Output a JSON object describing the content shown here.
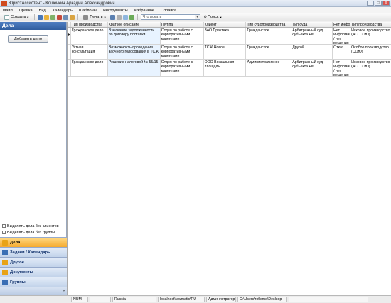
{
  "window": {
    "title": "ЮристАссистент - Кошечкин Аркадий Александрович",
    "minimize": "_",
    "maximize": "□",
    "close": "x"
  },
  "menu": [
    "Файл",
    "Правка",
    "Вид",
    "Календарь",
    "Шаблоны",
    "Инструменты",
    "Избранное",
    "Справка"
  ],
  "toolbar": {
    "create_label": "Создать",
    "print_label": "Печать",
    "search_placeholder": "Что искать",
    "search_button": "Поиск"
  },
  "left_panel": {
    "title": "Дела",
    "add_button": "Добавить дело",
    "checkboxes": [
      "Выделять дела без клиентов",
      "Выделять дела без группы"
    ]
  },
  "nav": {
    "items": [
      {
        "label": "Дела",
        "icon": "folder-icon",
        "color": "#e8a317",
        "active": true
      },
      {
        "label": "Задачи / Календарь",
        "icon": "calendar-icon",
        "color": "#3a6fb5",
        "active": false
      },
      {
        "label": "Другое",
        "icon": "folder-icon",
        "color": "#e8a317",
        "active": false
      },
      {
        "label": "Документы",
        "icon": "documents-icon",
        "color": "#e8a317",
        "active": false
      },
      {
        "label": "Группы",
        "icon": "groups-icon",
        "color": "#3a6fb5",
        "active": false
      }
    ],
    "expand_glyph": "»"
  },
  "table": {
    "columns": [
      "Тип производства",
      "Краткое описание",
      "Группа",
      "Клиент",
      "Тип судопроизводства",
      "Тип суда",
      "Нет информ",
      "Тип производства"
    ],
    "rows": [
      {
        "selected": true,
        "cells": [
          "Гражданское дело",
          "Взыскание задолженности по договору поставки",
          "Отдел по работе с корпоративными клиентами",
          "ЗАО Практика",
          "Гражданское",
          "Арбитражный суд субъекта РФ",
          "Нет информации / нет решения",
          "Исковое производство (АС, СОЮ)"
        ]
      },
      {
        "selected": false,
        "cells": [
          "Устная консультация",
          "Возможность проведения заочного голосования в ТСЖ",
          "Отдел по работе с корпоративными клиентами",
          "ТСЖ Новое",
          "Гражданское",
          "Другой",
          "Отказ",
          "Особое производство (СОЮ)"
        ]
      },
      {
        "selected": false,
        "cells": [
          "Гражданское дело",
          "Решение налоговой № 55/15",
          "Отдел по работе с корпоративными клиентами",
          "ООО Вокзальная площадь",
          "Административное",
          "Арбитражный суд субъекта РФ",
          "Нет информации / нет решения",
          "Исковое производство (АС, СОЮ)"
        ]
      }
    ]
  },
  "statusbar": {
    "num": "NUM",
    "lang": "Russia",
    "server": "localhost\\lawmatic\\RU",
    "role": "Администратор",
    "path": "C:\\Users\\rofleme\\Desktop"
  }
}
